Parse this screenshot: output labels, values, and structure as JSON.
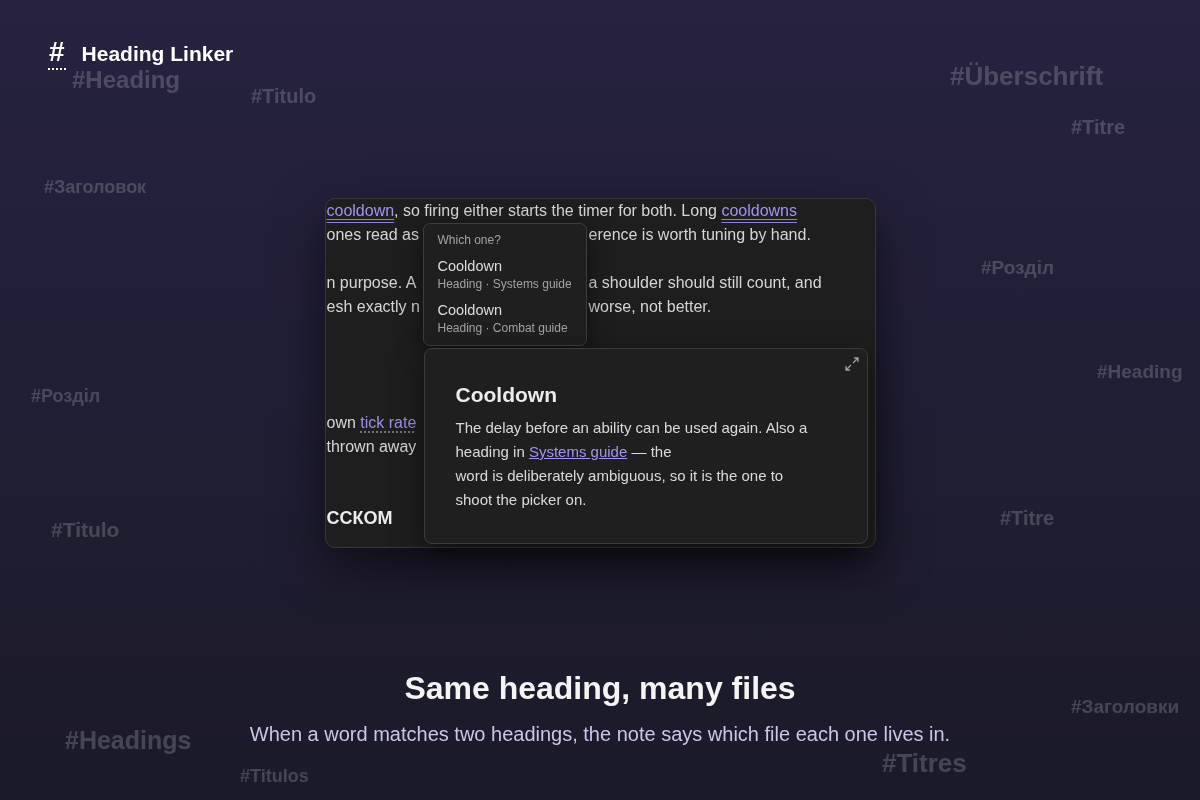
{
  "app": {
    "logo_mark": "#",
    "name": "Heading Linker"
  },
  "background_tags": [
    "#Heading",
    "#Titulo",
    "#Заголовок",
    "#Überschrift",
    "#Titre",
    "#Розділ",
    "#Heading",
    "#Розділ",
    "#Titulo",
    "#Titre",
    "#Заголовки",
    "#Headings",
    "#Titulos",
    "#Titres"
  ],
  "editor": {
    "blocks": [
      {
        "kind": "paragraph",
        "lines": [
          {
            "left": [
              {
                "kind": "ambiguous_link",
                "text": "cooldown"
              },
              {
                "kind": "text",
                "text": ", so firing either starts the timer for both. Long "
              },
              {
                "kind": "ambiguous_link",
                "text": "cooldowns"
              }
            ]
          },
          {
            "left": [
              {
                "kind": "text",
                "text": "ones read as"
              }
            ],
            "right": [
              {
                "kind": "text",
                "text": "erence is worth tuning by hand."
              }
            ]
          }
        ]
      },
      {
        "kind": "paragraph",
        "lines": [
          {
            "left": [
              {
                "kind": "text",
                "text": "n purpose. A"
              }
            ],
            "right": [
              {
                "kind": "text",
                "text": "a shoulder should still count, and"
              }
            ]
          },
          {
            "left": [
              {
                "kind": "text",
                "text": "esh exactly n"
              }
            ],
            "right": [
              {
                "kind": "text",
                "text": "worse, not better."
              }
            ]
          }
        ]
      },
      {
        "kind": "paragraph",
        "lines": [
          {
            "left": [
              {
                "kind": "text",
                "text": "own "
              },
              {
                "kind": "link",
                "text": "tick rate"
              }
            ]
          },
          {
            "left": [
              {
                "kind": "text",
                "text": "thrown away"
              }
            ]
          }
        ]
      },
      {
        "kind": "heading",
        "text": "ССКОМ"
      }
    ]
  },
  "picker": {
    "heading": "Which one?",
    "options": [
      {
        "title": "Cooldown",
        "detail": "Heading · Systems guide",
        "selected": false
      },
      {
        "title": "Cooldown",
        "detail": "Heading · Combat guide",
        "selected": false
      }
    ]
  },
  "preview": {
    "title": "Cooldown",
    "body": [
      {
        "kind": "text",
        "text": "The delay before an ability can be used again. Also a heading in "
      },
      {
        "kind": "link",
        "text": "Systems guide"
      },
      {
        "kind": "text",
        "text": " — the"
      },
      {
        "kind": "break"
      },
      {
        "kind": "text",
        "text": "word is deliberately ambiguous, so it is the one to shoot the picker on."
      }
    ]
  },
  "hero": {
    "title": "Same heading, many files",
    "subtitle": "When a word matches two headings, the note says which file each one lives in."
  }
}
